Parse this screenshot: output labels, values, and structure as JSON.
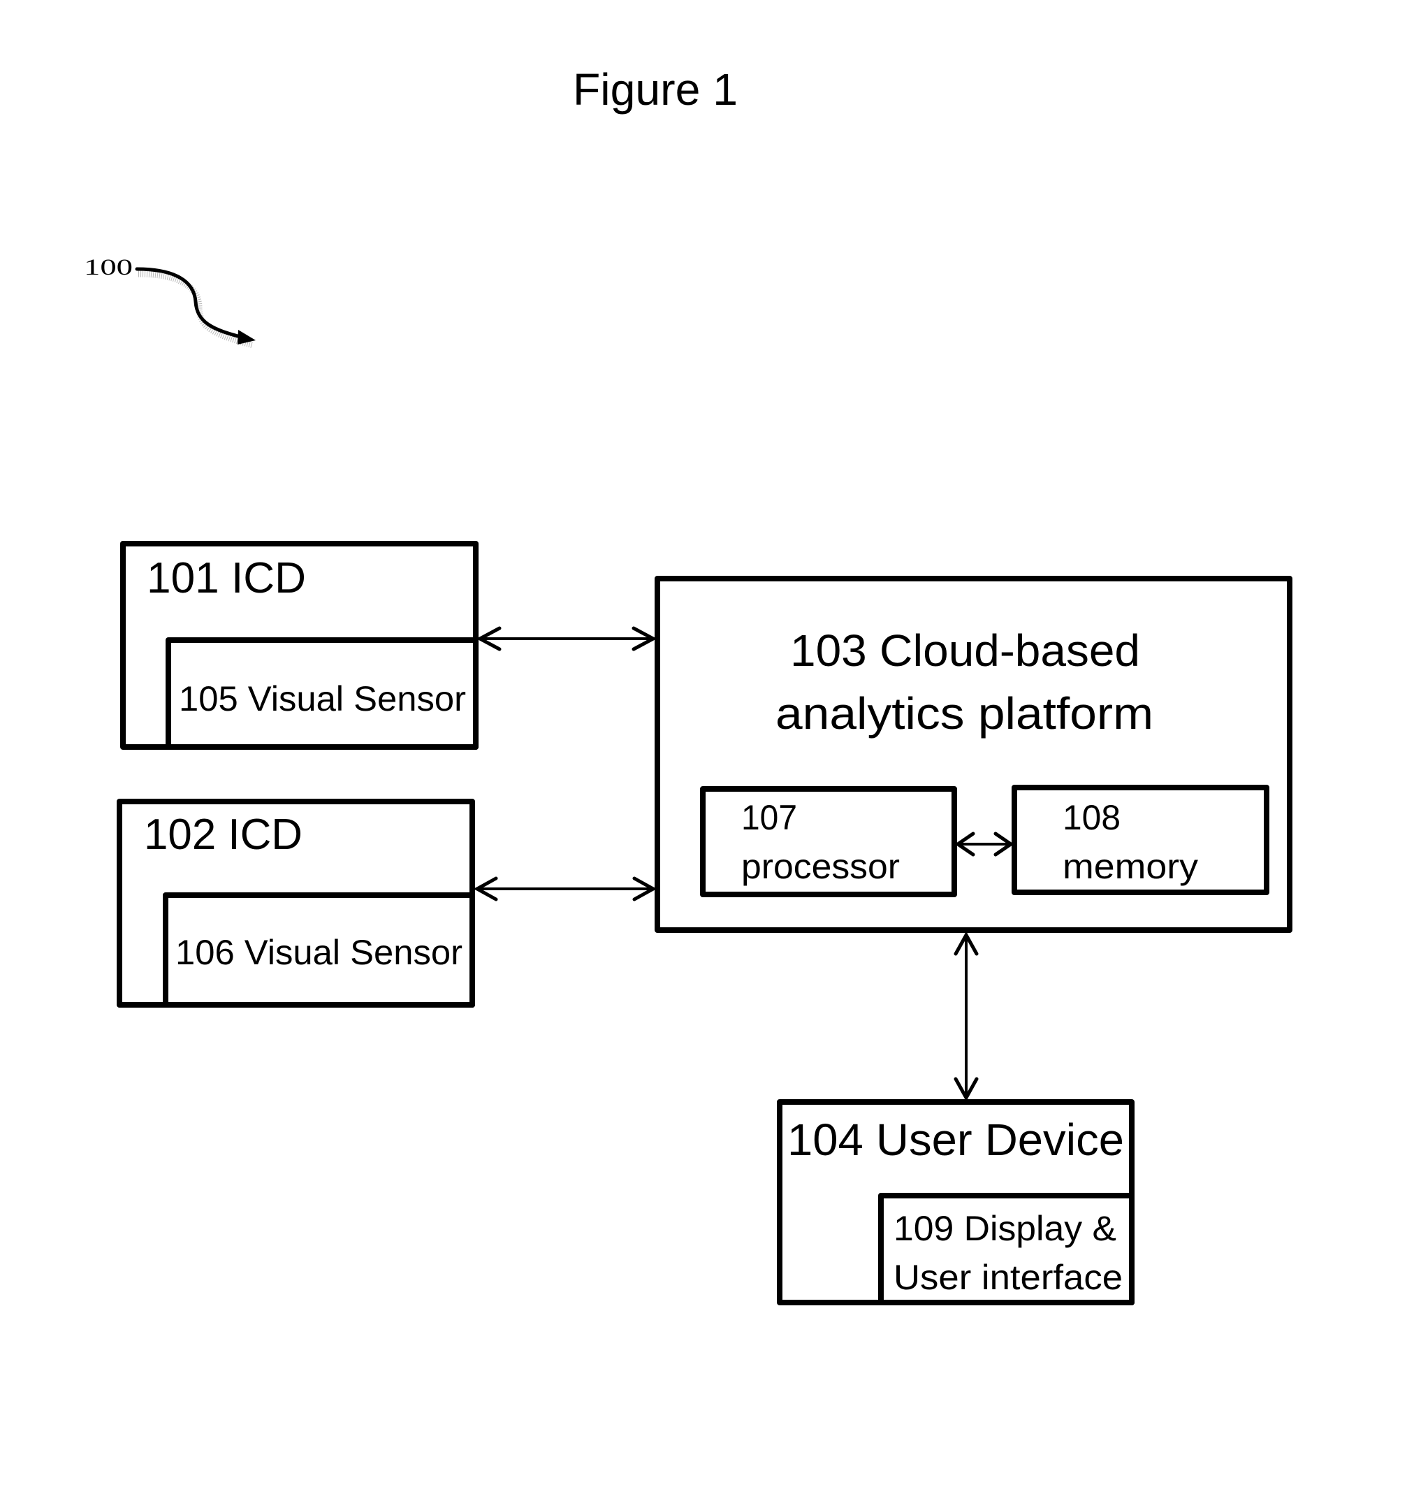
{
  "figure": {
    "title": "Figure 1",
    "reference_numeral": "100"
  },
  "nodes": {
    "icd_101": {
      "label": "101 ICD"
    },
    "sensor_105": {
      "label": "105 Visual Sensor"
    },
    "icd_102": {
      "label": "102 ICD"
    },
    "sensor_106": {
      "label": "106 Visual Sensor"
    },
    "platform_103": {
      "line1": "103 Cloud-based",
      "line2": "analytics platform"
    },
    "processor_107": {
      "line1": "107",
      "line2": "processor"
    },
    "memory_108": {
      "line1": "108",
      "line2": "memory"
    },
    "user_device_104": {
      "label": "104 User Device"
    },
    "display_109": {
      "line1": "109 Display &",
      "line2": "User interface"
    }
  },
  "connections": [
    {
      "from": "101 ICD / 105 Visual Sensor",
      "to": "103 Cloud-based analytics platform",
      "direction": "bidirectional"
    },
    {
      "from": "102 ICD / 106 Visual Sensor",
      "to": "103 Cloud-based analytics platform",
      "direction": "bidirectional"
    },
    {
      "from": "107 processor",
      "to": "108 memory",
      "direction": "bidirectional"
    },
    {
      "from": "103 Cloud-based analytics platform",
      "to": "104 User Device",
      "direction": "bidirectional"
    }
  ],
  "colors": {
    "ink": "#000000",
    "background": "#ffffff"
  }
}
